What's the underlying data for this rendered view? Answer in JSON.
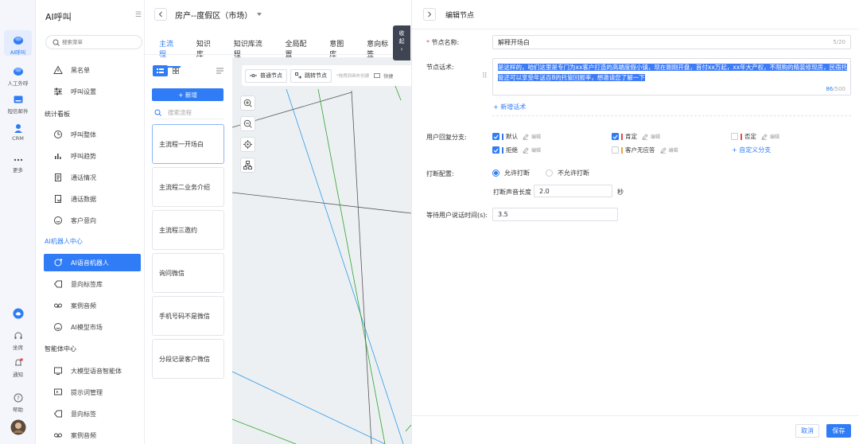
{
  "rail": {
    "items": [
      {
        "label": "AI呼叫",
        "icon": "ai-call-icon",
        "active": true
      },
      {
        "label": "人工外呼",
        "icon": "manual-call-icon"
      },
      {
        "label": "短信邮件",
        "icon": "sms-email-icon"
      },
      {
        "label": "CRM",
        "icon": "crm-icon"
      },
      {
        "label": "更多",
        "icon": "more-icon"
      }
    ],
    "bottom": [
      {
        "label": "",
        "icon": "app-logo-icon"
      },
      {
        "label": "坐席",
        "icon": "headset-icon"
      },
      {
        "label": "通知",
        "icon": "bell-icon"
      },
      {
        "label": "帮助",
        "icon": "help-icon"
      },
      {
        "label": "",
        "icon": "avatar"
      }
    ]
  },
  "menu": {
    "title": "AI呼叫",
    "search_placeholder": "搜索菜单",
    "items": [
      {
        "label": "黑名单",
        "icon": "warning-icon"
      },
      {
        "label": "呼叫设置",
        "icon": "sliders-icon"
      }
    ],
    "section_stats": "统计看板",
    "stats_items": [
      {
        "label": "呼叫整体",
        "icon": "clock-icon"
      },
      {
        "label": "呼叫趋势",
        "icon": "bar-chart-icon"
      },
      {
        "label": "通话情况",
        "icon": "document-icon"
      },
      {
        "label": "通话数据",
        "icon": "data-file-icon"
      },
      {
        "label": "客户意向",
        "icon": "smile-icon"
      }
    ],
    "section_robot": "AI机器人中心",
    "robot_items": [
      {
        "label": "AI语音机器人",
        "icon": "robot-icon",
        "active": true
      },
      {
        "label": "意向标签库",
        "icon": "tag-icon"
      },
      {
        "label": "案例音频",
        "icon": "audio-icon"
      },
      {
        "label": "AI模型市场",
        "icon": "model-icon"
      }
    ],
    "section_agent": "智能体中心",
    "agent_items": [
      {
        "label": "大模型语音智能体",
        "icon": "monitor-icon"
      },
      {
        "label": "提示词管理",
        "icon": "prompt-icon"
      },
      {
        "label": "意向标签",
        "icon": "tag-icon"
      },
      {
        "label": "案例音频",
        "icon": "audio-icon"
      }
    ]
  },
  "main": {
    "breadcrumb": "房产--度假区（市场）",
    "tabs": [
      "主流程",
      "知识库",
      "知识库流程",
      "全局配置",
      "意图库",
      "意向标签"
    ],
    "collapse_label": [
      "收",
      "起"
    ],
    "new_button": "+ 新增",
    "flow_search_placeholder": "搜索流程",
    "flows": [
      "主流程一开场白",
      "主流程二业务介绍",
      "主流程三邀约",
      "询问微信",
      "手机号码不是微信",
      "分段记录客户微信"
    ],
    "canvas": {
      "normal_node": "普通节点",
      "jump_node": "跳转节点",
      "hint": "*拖拽到画布创建",
      "shortcut": "快捷"
    }
  },
  "panel": {
    "title": "编辑节点",
    "node_name_label": "节点名称:",
    "node_name_value": "解释开场白",
    "node_name_count": "5/20",
    "script_label": "节点话术:",
    "script_text": "是这样的，咱们这里是专门为xx客户打造的高端度假小镇，现在刚刚开盘，首付xx万起，xx年大产权，不限购的精装修现房，民宿托管还可以享受年送百8的托管回报率，想邀请您了解一下",
    "script_count_current": "86",
    "script_count_max": "/500",
    "add_script": "+ 新增话术",
    "reply_label": "用户回复分支:",
    "branches": [
      {
        "label": "默认",
        "checked": true,
        "color": "#2f7cf6"
      },
      {
        "label": "肯定",
        "checked": true,
        "color": "#e34d4d"
      },
      {
        "label": "否定",
        "checked": false,
        "color": "#e34d4d"
      },
      {
        "label": "拒绝",
        "checked": true,
        "color": "#2f7cf6"
      },
      {
        "label": "客户无应答",
        "checked": false,
        "color": "#f2a33a"
      }
    ],
    "edit_label": "编辑",
    "custom_branch": "+ 自定义分支",
    "interrupt_label": "打断配置:",
    "allow_interrupt": "允许打断",
    "disallow_interrupt": "不允许打断",
    "interrupt_len_label": "打断声音长度",
    "interrupt_len_value": "2.0",
    "interrupt_len_unit": "秒",
    "wait_label": "等待用户说话时间(s):",
    "wait_value": "3.5",
    "cancel": "取消",
    "save": "保存"
  },
  "colors": {
    "accent": "#2f7cf6",
    "rail_bg": "#f4f6fb",
    "canvas_bg": "#edf0f3",
    "selection": "#3d7bf7"
  }
}
